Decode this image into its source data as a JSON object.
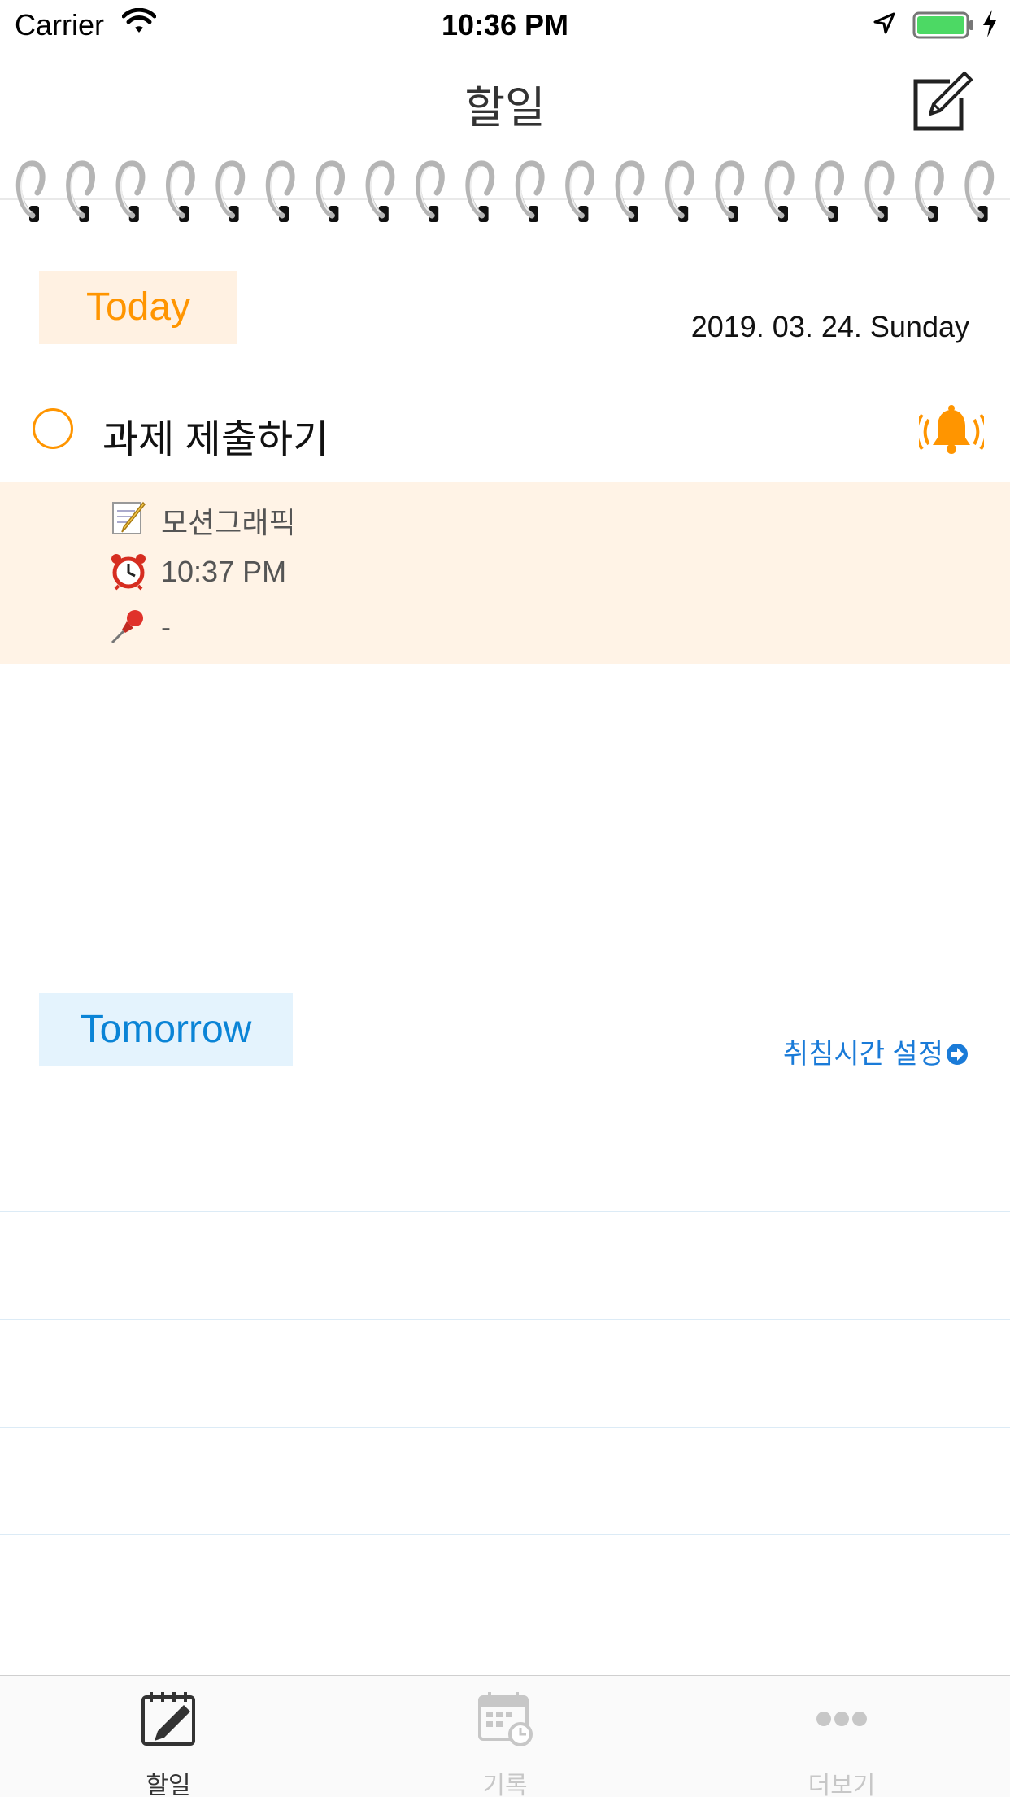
{
  "status_bar": {
    "carrier": "Carrier",
    "time": "10:36 PM"
  },
  "nav": {
    "title": "할일"
  },
  "today": {
    "label": "Today",
    "date": "2019. 03. 24. Sunday",
    "task": {
      "title": "과제 제출하기",
      "memo": "모션그래픽",
      "alarm_time": "10:37 PM",
      "pin": "-"
    }
  },
  "tomorrow": {
    "label": "Tomorrow",
    "bedtime_link": "취침시간 설정"
  },
  "tabs": [
    {
      "label": "할일",
      "icon": "todo-notepad-icon",
      "selected": true
    },
    {
      "label": "기록",
      "icon": "calendar-clock-icon",
      "selected": false
    },
    {
      "label": "더보기",
      "icon": "more-dots-icon",
      "selected": false
    }
  ],
  "colors": {
    "accent_orange": "#ff9500",
    "accent_blue": "#0a84d6",
    "tab_inactive": "#c7c7c7"
  }
}
